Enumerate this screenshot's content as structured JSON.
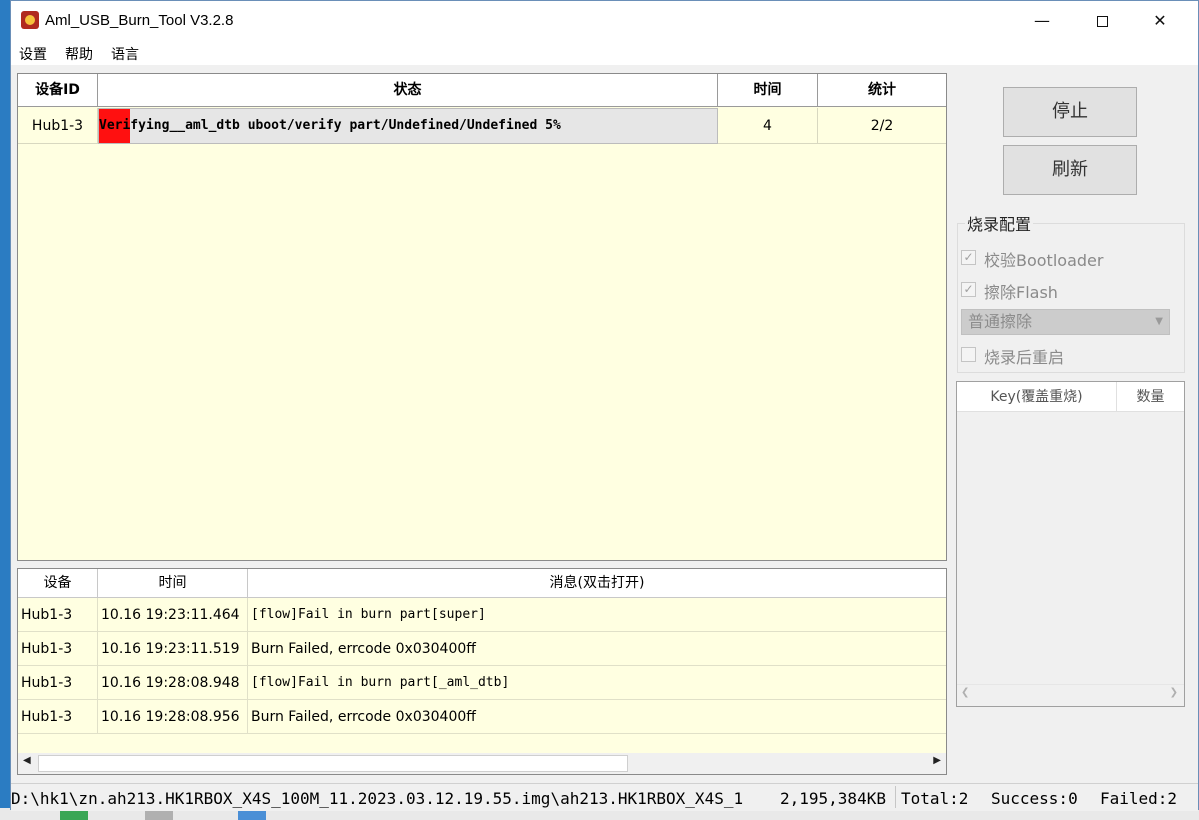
{
  "window": {
    "title": "Aml_USB_Burn_Tool V3.2.8"
  },
  "menu": [
    {
      "label": "设置"
    },
    {
      "label": "帮助"
    },
    {
      "label": "语言"
    }
  ],
  "device_table": {
    "headers": {
      "device_id": "设备ID",
      "status": "状态",
      "time": "时间",
      "stats": "统计"
    },
    "rows": [
      {
        "device_id": "Hub1-3",
        "status": "Verifying__aml_dtb uboot/verify part/Undefined/Undefined 5%",
        "progress_percent": 5,
        "time": "4",
        "stats": "2/2"
      }
    ]
  },
  "buttons": {
    "stop": "停止",
    "refresh": "刷新"
  },
  "burn_config": {
    "title": "烧录配置",
    "verify_bootloader": {
      "label": "校验Bootloader",
      "checked": true
    },
    "erase_flash": {
      "label": "擦除Flash",
      "checked": true
    },
    "erase_mode": {
      "selected": "普通擦除"
    },
    "reboot_after": {
      "label": "烧录后重启",
      "checked": false
    }
  },
  "key_table": {
    "headers": {
      "key": "Key(覆盖重烧)",
      "count": "数量"
    }
  },
  "log_table": {
    "headers": {
      "device": "设备",
      "time": "时间",
      "message": "消息(双击打开)"
    },
    "rows": [
      {
        "device": "Hub1-3",
        "time": "10.16 19:23:11.464",
        "message": "[flow]Fail in burn part[super]",
        "mono": true
      },
      {
        "device": "Hub1-3",
        "time": "10.16 19:23:11.519",
        "message": "Burn Failed, errcode 0x030400ff",
        "mono": false
      },
      {
        "device": "Hub1-3",
        "time": "10.16 19:28:08.948",
        "message": "[flow]Fail in burn part[_aml_dtb]",
        "mono": true
      },
      {
        "device": "Hub1-3",
        "time": "10.16 19:28:08.956",
        "message": "Burn Failed, errcode 0x030400ff",
        "mono": false
      }
    ]
  },
  "status_bar": {
    "image_path": "D:\\hk1\\zn.ah213.HK1RBOX_X4S_100M_11.2023.03.12.19.55.img\\ah213.HK1RBOX_X4S_1",
    "image_size": "2,195,384KB",
    "total": "Total:2",
    "success": "Success:0",
    "failed": "Failed:2"
  },
  "icons": {
    "app": "amlogic-burn-icon",
    "close": "close-icon",
    "minimize": "minimize-icon",
    "maximize": "maximize-icon"
  },
  "colors": {
    "progress": "#ff1010",
    "table_bg": "#ffffe1"
  }
}
